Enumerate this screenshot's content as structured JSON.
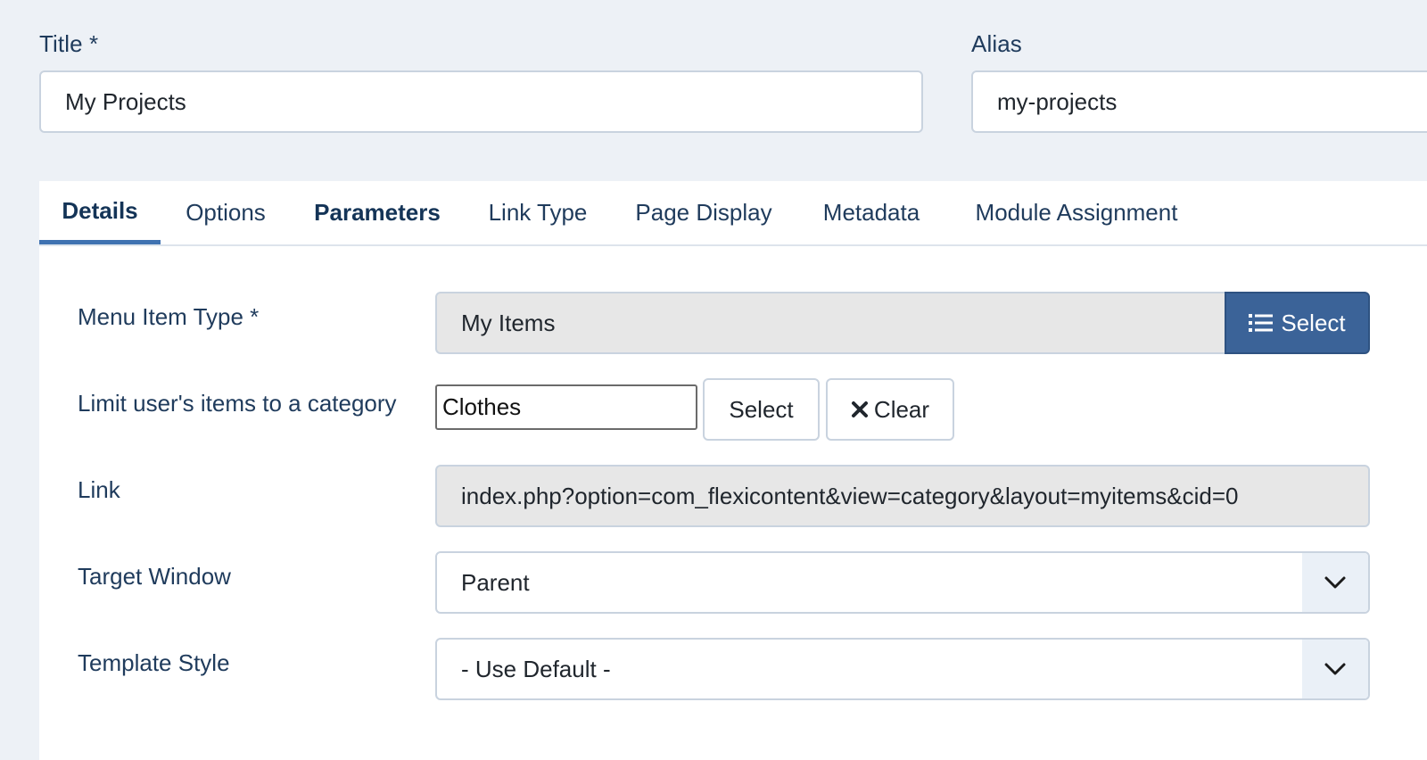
{
  "header": {
    "title_label": "Title *",
    "title_value": "My Projects",
    "alias_label": "Alias",
    "alias_value": "my-projects"
  },
  "tabs": [
    {
      "label": "Details",
      "active": true
    },
    {
      "label": "Options",
      "active": false
    },
    {
      "label": "Parameters",
      "active": false
    },
    {
      "label": "Link Type",
      "active": false
    },
    {
      "label": "Page Display",
      "active": false
    },
    {
      "label": "Metadata",
      "active": false
    },
    {
      "label": "Module Assignment",
      "active": false
    }
  ],
  "details": {
    "menu_item_type": {
      "label": "Menu Item Type *",
      "value": "My Items",
      "button_label": "Select",
      "button_icon": "list-icon"
    },
    "category_limit": {
      "label": "Limit user's items to a category",
      "value": "Clothes",
      "select_label": "Select",
      "clear_label": "Clear",
      "clear_icon": "times-icon"
    },
    "link": {
      "label": "Link",
      "value": "index.php?option=com_flexicontent&view=category&layout=myitems&cid=0"
    },
    "target_window": {
      "label": "Target Window",
      "value": "Parent"
    },
    "template_style": {
      "label": "Template Style",
      "value": "- Use Default -"
    }
  },
  "colors": {
    "page_bg": "#edf1f6",
    "primary_button": "#3b6398",
    "active_tab_underline": "#3f72b1",
    "label_text": "#1f3b5c"
  }
}
